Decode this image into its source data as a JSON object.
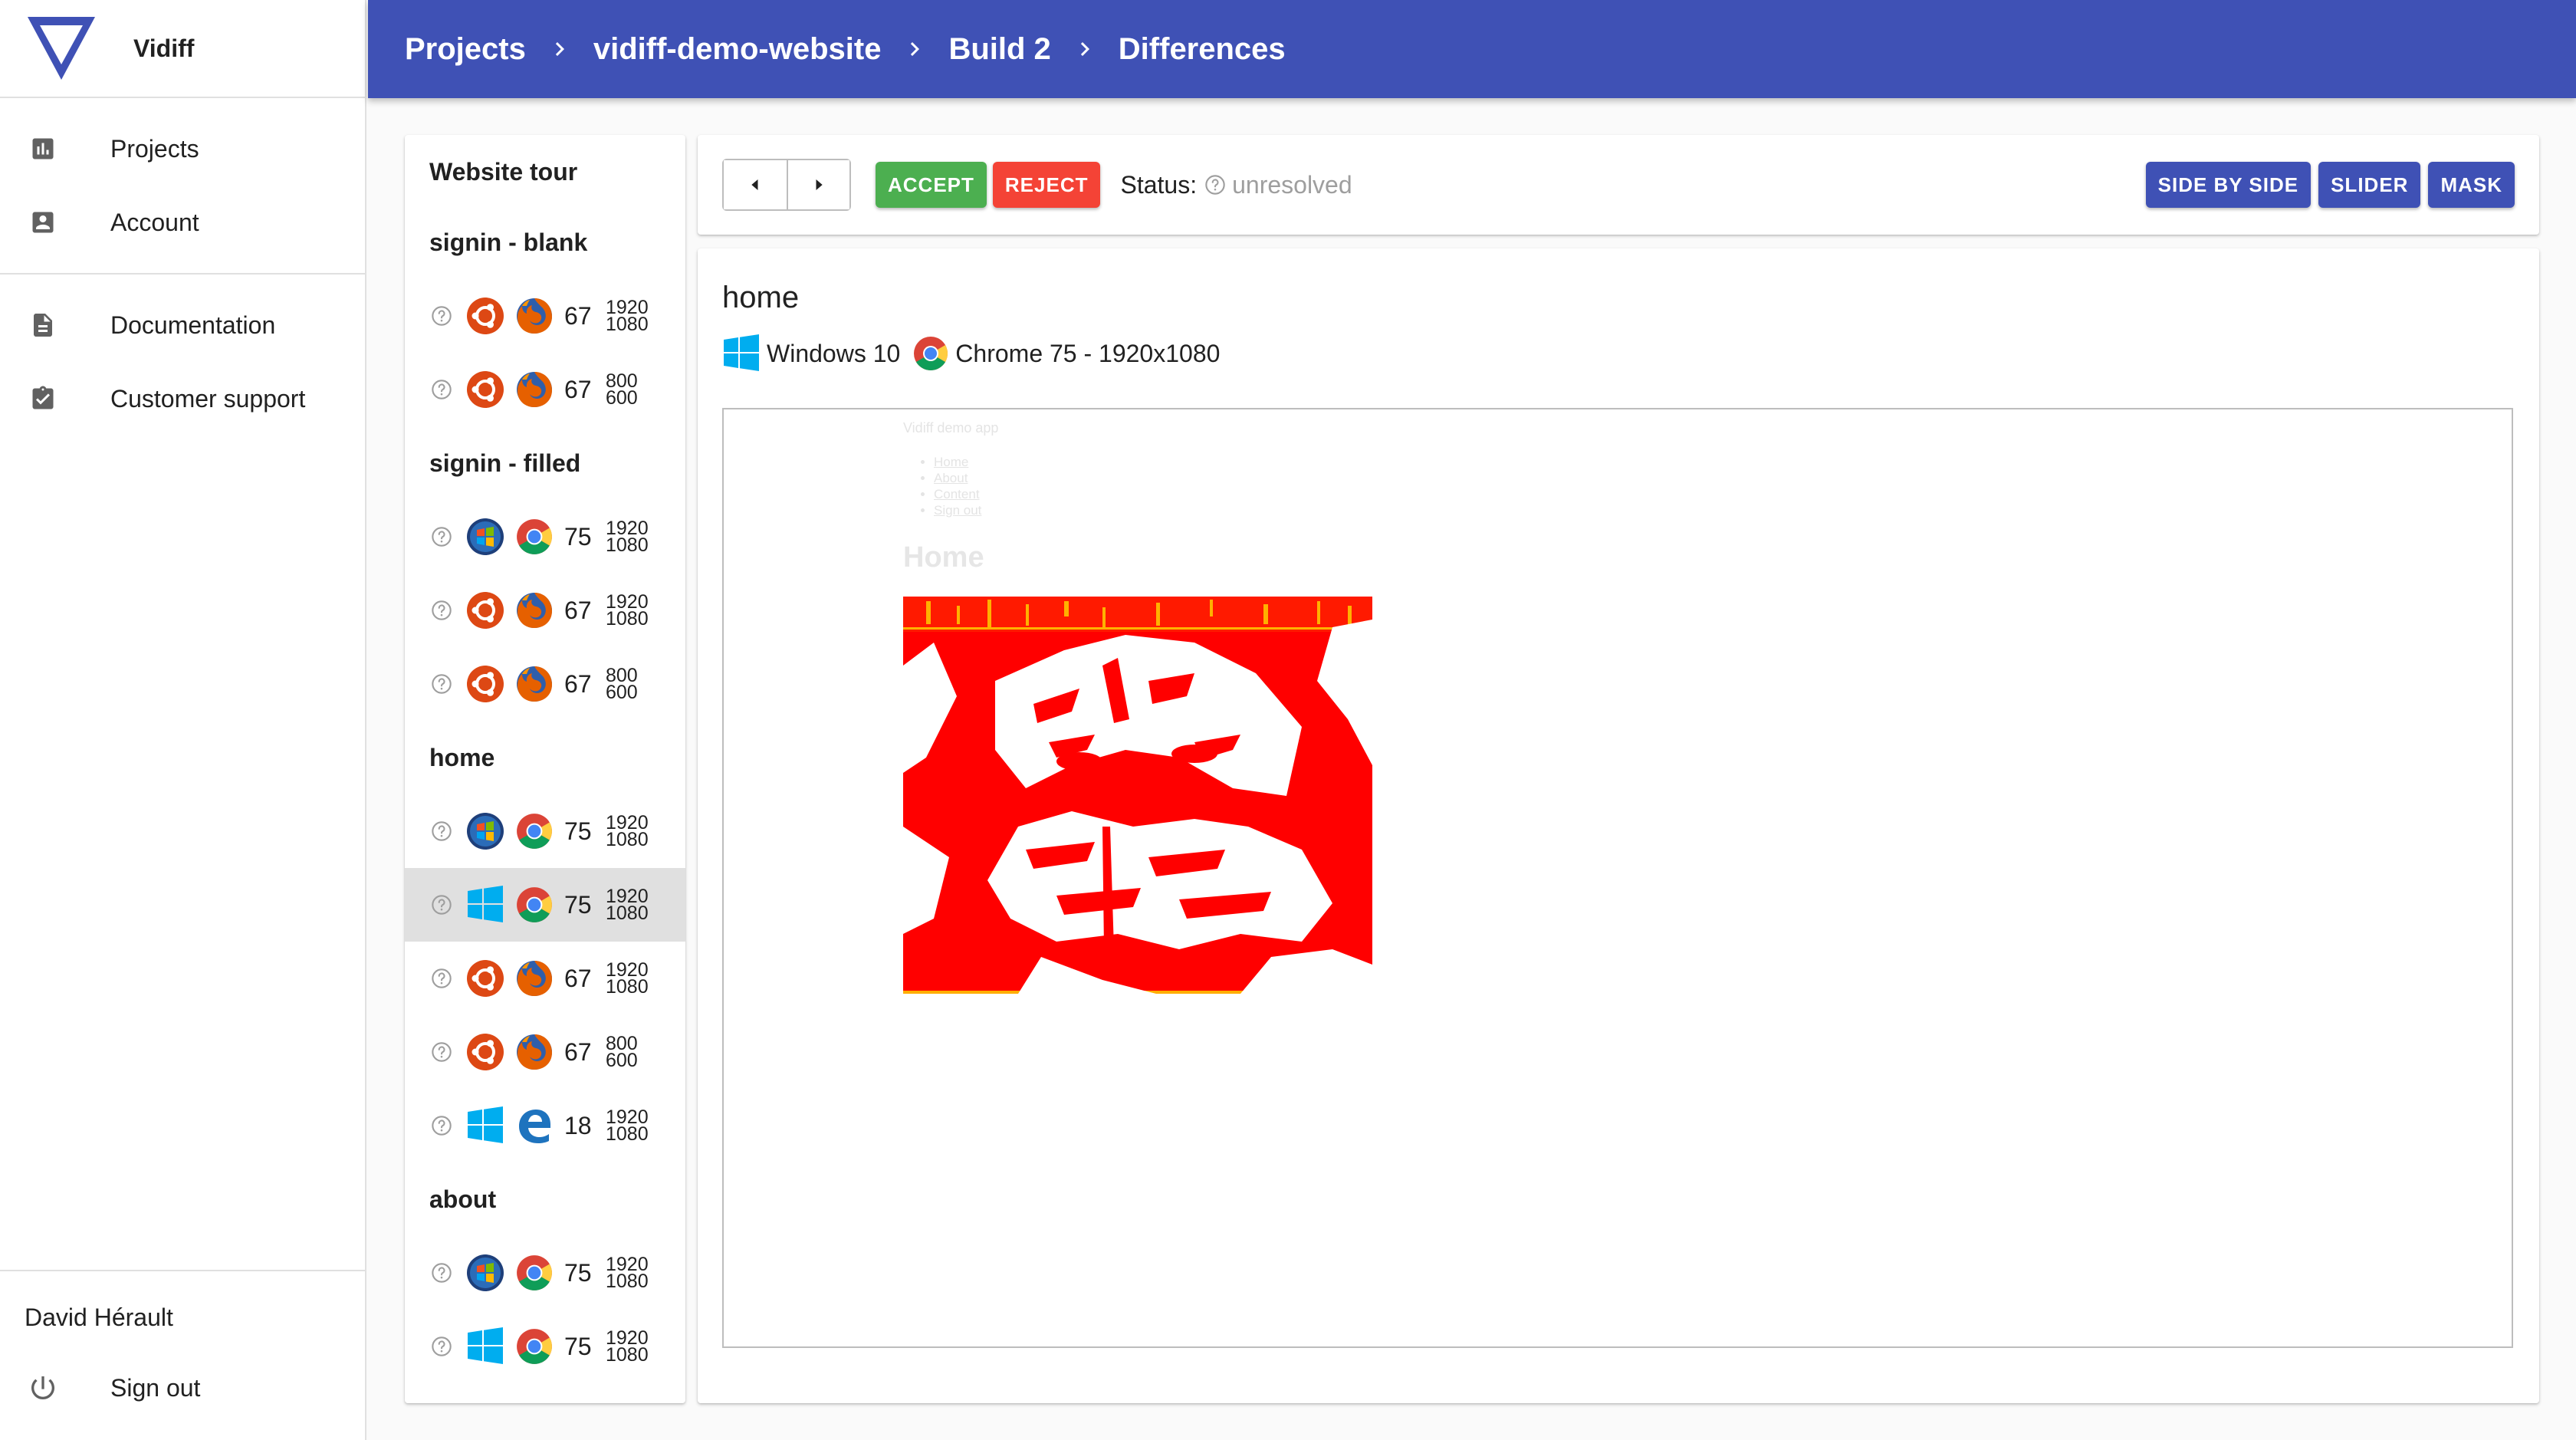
{
  "app": {
    "name": "Vidiff"
  },
  "colors": {
    "primary": "#3f51b5",
    "accept": "#4caf50",
    "reject": "#f44336",
    "diff": "#ff0000"
  },
  "nav": {
    "main": [
      {
        "label": "Projects",
        "icon": "bar-chart-icon"
      },
      {
        "label": "Account",
        "icon": "account-box-icon"
      }
    ],
    "secondary": [
      {
        "label": "Documentation",
        "icon": "document-icon"
      },
      {
        "label": "Customer support",
        "icon": "assignment-check-icon"
      }
    ]
  },
  "user": {
    "name": "David Hérault",
    "signout_label": "Sign out"
  },
  "breadcrumb": [
    "Projects",
    "vidiff-demo-website",
    "Build 2",
    "Differences"
  ],
  "tests": {
    "title": "Website tour",
    "groups": [
      {
        "name": "signin - blank",
        "rows": [
          {
            "os": "ubuntu",
            "browser": "firefox",
            "version": "67",
            "width": "1920",
            "height": "1080"
          },
          {
            "os": "ubuntu",
            "browser": "firefox",
            "version": "67",
            "width": "800",
            "height": "600"
          }
        ]
      },
      {
        "name": "signin - filled",
        "rows": [
          {
            "os": "windows7",
            "browser": "chrome",
            "version": "75",
            "width": "1920",
            "height": "1080"
          },
          {
            "os": "ubuntu",
            "browser": "firefox",
            "version": "67",
            "width": "1920",
            "height": "1080"
          },
          {
            "os": "ubuntu",
            "browser": "firefox",
            "version": "67",
            "width": "800",
            "height": "600"
          }
        ]
      },
      {
        "name": "home",
        "rows": [
          {
            "os": "windows7",
            "browser": "chrome",
            "version": "75",
            "width": "1920",
            "height": "1080"
          },
          {
            "os": "windows10",
            "browser": "chrome",
            "version": "75",
            "width": "1920",
            "height": "1080",
            "selected": true
          },
          {
            "os": "ubuntu",
            "browser": "firefox",
            "version": "67",
            "width": "1920",
            "height": "1080"
          },
          {
            "os": "ubuntu",
            "browser": "firefox",
            "version": "67",
            "width": "800",
            "height": "600"
          },
          {
            "os": "windows10",
            "browser": "edge",
            "version": "18",
            "width": "1920",
            "height": "1080"
          }
        ]
      },
      {
        "name": "about",
        "rows": [
          {
            "os": "windows7",
            "browser": "chrome",
            "version": "75",
            "width": "1920",
            "height": "1080"
          },
          {
            "os": "windows10",
            "browser": "chrome",
            "version": "75",
            "width": "1920",
            "height": "1080"
          }
        ]
      }
    ]
  },
  "toolbar": {
    "accept_label": "ACCEPT",
    "reject_label": "REJECT",
    "status_label": "Status:",
    "status_value": "unresolved",
    "view_modes": [
      "SIDE BY SIDE",
      "SLIDER",
      "MASK"
    ]
  },
  "diff": {
    "title": "home",
    "os_name": "Windows 10",
    "browser_desc": "Chrome 75 - 1920x1080",
    "preview": {
      "app_title": "Vidiff demo app",
      "links": [
        "Home",
        "About",
        "Content",
        "Sign out"
      ],
      "heading": "Home"
    }
  }
}
